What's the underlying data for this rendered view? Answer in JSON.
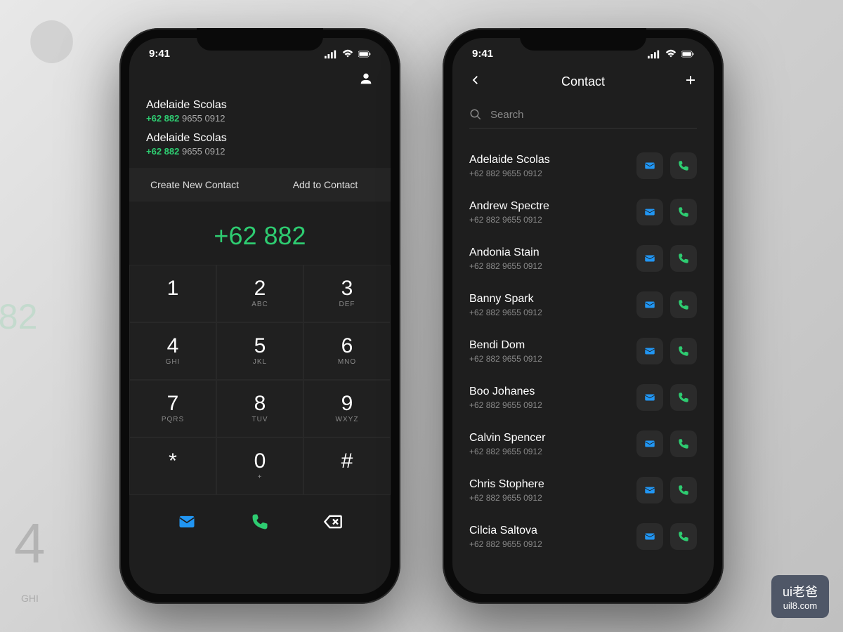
{
  "status": {
    "time": "9:41"
  },
  "dialer": {
    "suggestions": [
      {
        "name": "Adelaide Scolas",
        "prefix": "+62 882",
        "rest": " 9655 0912"
      },
      {
        "name": "Adelaide Scolas",
        "prefix": "+62 882",
        "rest": " 9655 0912"
      }
    ],
    "actions": {
      "create": "Create New Contact",
      "add": "Add to Contact"
    },
    "dialed": "+62 882",
    "keys": [
      {
        "num": "1",
        "letters": ""
      },
      {
        "num": "2",
        "letters": "ABC"
      },
      {
        "num": "3",
        "letters": "DEF"
      },
      {
        "num": "4",
        "letters": "GHI"
      },
      {
        "num": "5",
        "letters": "JKL"
      },
      {
        "num": "6",
        "letters": "MNO"
      },
      {
        "num": "7",
        "letters": "PQRS"
      },
      {
        "num": "8",
        "letters": "TUV"
      },
      {
        "num": "9",
        "letters": "WXYZ"
      },
      {
        "num": "*",
        "letters": ""
      },
      {
        "num": "0",
        "letters": "+"
      },
      {
        "num": "#",
        "letters": ""
      }
    ]
  },
  "contacts": {
    "title": "Contact",
    "search_placeholder": "Search",
    "items": [
      {
        "name": "Adelaide Scolas",
        "phone": "+62 882 9655 0912"
      },
      {
        "name": "Andrew Spectre",
        "phone": "+62 882 9655 0912"
      },
      {
        "name": "Andonia Stain",
        "phone": "+62 882 9655 0912"
      },
      {
        "name": "Banny Spark",
        "phone": "+62 882 9655 0912"
      },
      {
        "name": "Bendi Dom",
        "phone": "+62 882 9655 0912"
      },
      {
        "name": "Boo Johanes",
        "phone": "+62 882 9655 0912"
      },
      {
        "name": "Calvin Spencer",
        "phone": "+62 882 9655 0912"
      },
      {
        "name": "Chris Stophere",
        "phone": "+62 882 9655 0912"
      },
      {
        "name": "Cilcia Saltova",
        "phone": "+62 882 9655 0912"
      }
    ]
  },
  "watermark": {
    "top": "ui老爸",
    "bottom": "uil8.com"
  }
}
